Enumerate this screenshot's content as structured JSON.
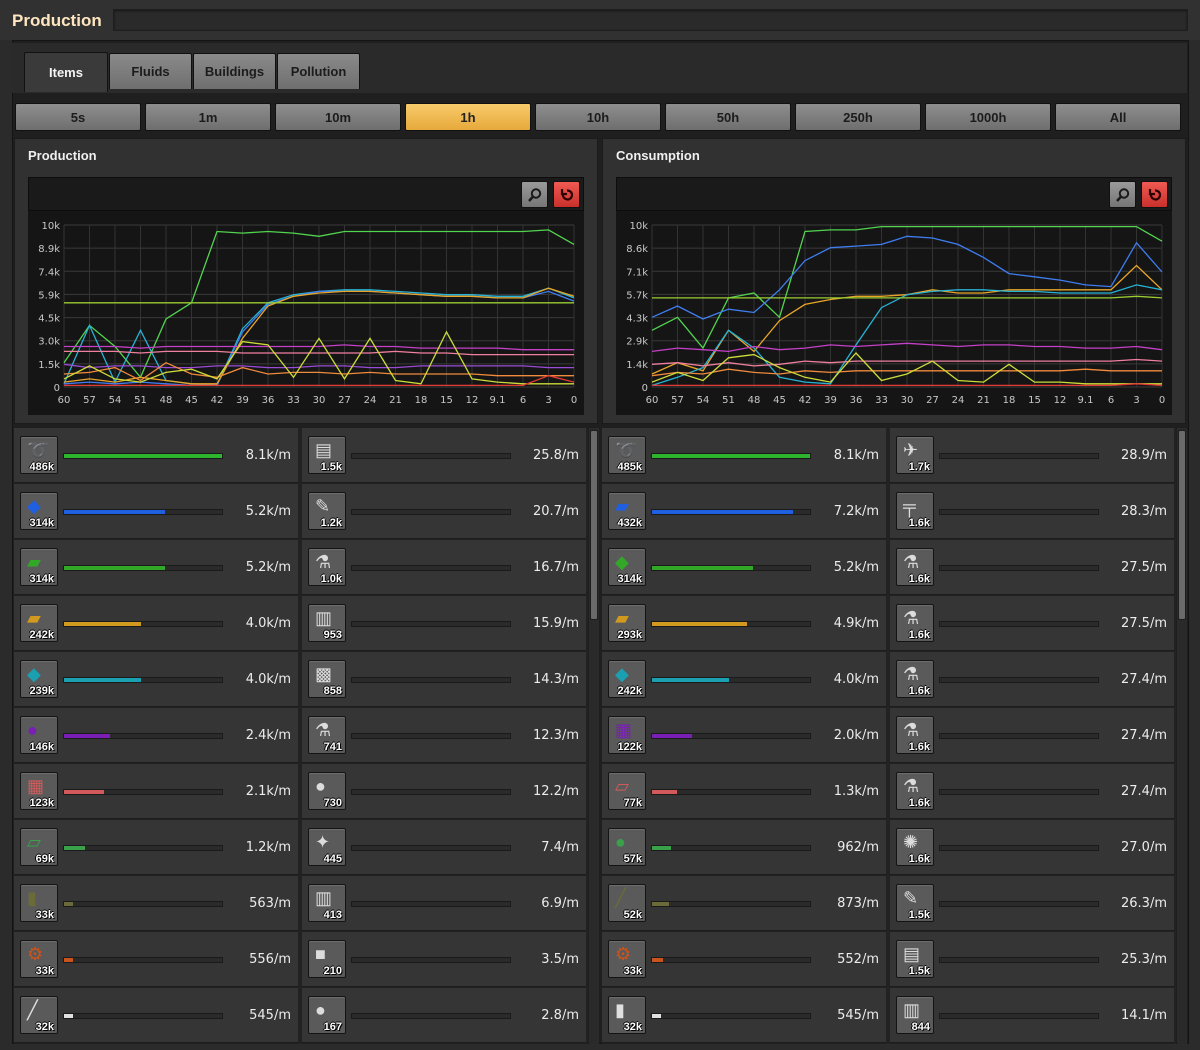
{
  "window": {
    "title": "Production"
  },
  "tabs": [
    {
      "label": "Items",
      "active": true
    },
    {
      "label": "Fluids",
      "active": false
    },
    {
      "label": "Buildings",
      "active": false
    },
    {
      "label": "Pollution",
      "active": false
    }
  ],
  "time_ranges": [
    "5s",
    "1m",
    "10m",
    "1h",
    "10h",
    "50h",
    "250h",
    "1000h",
    "All"
  ],
  "active_time_range": "1h",
  "production": {
    "title": "Production",
    "y_ticks": [
      "10k",
      "8.9k",
      "7.4k",
      "5.9k",
      "4.5k",
      "3.0k",
      "1.5k",
      "0"
    ],
    "x_ticks": [
      "60",
      "57",
      "54",
      "51",
      "48",
      "45",
      "42",
      "39",
      "36",
      "33",
      "30",
      "27",
      "24",
      "21",
      "18",
      "15",
      "12",
      "9.1",
      "6",
      "3",
      "0"
    ],
    "left_items": [
      {
        "icon": "copper-cable-icon",
        "glyph": "➰",
        "count": "486k",
        "rate": "8.1k/m",
        "fraction": 1.0,
        "color": "#2eb52e"
      },
      {
        "icon": "iron-ore-icon",
        "glyph": "◆",
        "count": "314k",
        "rate": "5.2k/m",
        "fraction": 0.64,
        "color": "#1f5fe0"
      },
      {
        "icon": "iron-plate-icon",
        "glyph": "▰",
        "count": "314k",
        "rate": "5.2k/m",
        "fraction": 0.64,
        "color": "#33a828"
      },
      {
        "icon": "copper-plate-icon",
        "glyph": "▰",
        "count": "242k",
        "rate": "4.0k/m",
        "fraction": 0.49,
        "color": "#d19a1e"
      },
      {
        "icon": "copper-ore-icon",
        "glyph": "◆",
        "count": "239k",
        "rate": "4.0k/m",
        "fraction": 0.49,
        "color": "#1aa0b0"
      },
      {
        "icon": "coal-icon",
        "glyph": "●",
        "count": "146k",
        "rate": "2.4k/m",
        "fraction": 0.29,
        "color": "#7a1fb5"
      },
      {
        "icon": "electronic-circuit-icon",
        "glyph": "▦",
        "count": "123k",
        "rate": "2.1k/m",
        "fraction": 0.25,
        "color": "#d25a5a"
      },
      {
        "icon": "steel-plate-icon",
        "glyph": "▱",
        "count": "69k",
        "rate": "1.2k/m",
        "fraction": 0.13,
        "color": "#3aa04a"
      },
      {
        "icon": "explosives-icon",
        "glyph": "▮",
        "count": "33k",
        "rate": "563/m",
        "fraction": 0.06,
        "color": "#6b6b3a"
      },
      {
        "icon": "iron-gear-icon",
        "glyph": "⚙",
        "count": "33k",
        "rate": "556/m",
        "fraction": 0.06,
        "color": "#c9541d"
      },
      {
        "icon": "iron-stick-icon",
        "glyph": "╱",
        "count": "32k",
        "rate": "545/m",
        "fraction": 0.06,
        "color": "#e0e0e0"
      }
    ],
    "right_items": [
      {
        "icon": "advanced-circuit-icon",
        "glyph": "▤",
        "count": "1.5k",
        "rate": "25.8/m"
      },
      {
        "icon": "inserter-icon",
        "glyph": "✎",
        "count": "1.2k",
        "rate": "20.7/m"
      },
      {
        "icon": "science-pack-icon",
        "glyph": "⚗",
        "count": "1.0k",
        "rate": "16.7/m"
      },
      {
        "icon": "grenade-icon",
        "glyph": "▥",
        "count": "953",
        "rate": "15.9/m"
      },
      {
        "icon": "engine-unit-icon",
        "glyph": "▩",
        "count": "858",
        "rate": "14.3/m"
      },
      {
        "icon": "chemical-pack-icon",
        "glyph": "⚗",
        "count": "741",
        "rate": "12.3/m"
      },
      {
        "icon": "stone-icon",
        "glyph": "●",
        "count": "730",
        "rate": "12.2/m"
      },
      {
        "icon": "solar-panel-icon",
        "glyph": "✦",
        "count": "445",
        "rate": "7.4/m"
      },
      {
        "icon": "wall-icon",
        "glyph": "▥",
        "count": "413",
        "rate": "6.9/m"
      },
      {
        "icon": "concrete-icon",
        "glyph": "■",
        "count": "210",
        "rate": "3.5/m"
      },
      {
        "icon": "uranium-ore-icon",
        "glyph": "●",
        "count": "167",
        "rate": "2.8/m"
      }
    ]
  },
  "consumption": {
    "title": "Consumption",
    "y_ticks": [
      "10k",
      "8.6k",
      "7.1k",
      "5.7k",
      "4.3k",
      "2.9k",
      "1.4k",
      "0"
    ],
    "x_ticks": [
      "60",
      "57",
      "54",
      "51",
      "48",
      "45",
      "42",
      "39",
      "36",
      "33",
      "30",
      "27",
      "24",
      "21",
      "18",
      "15",
      "12",
      "9.1",
      "6",
      "3",
      "0"
    ],
    "left_items": [
      {
        "icon": "copper-cable-icon",
        "glyph": "➰",
        "count": "485k",
        "rate": "8.1k/m",
        "fraction": 1.0,
        "color": "#2eb52e"
      },
      {
        "icon": "iron-plate-icon",
        "glyph": "▰",
        "count": "432k",
        "rate": "7.2k/m",
        "fraction": 0.89,
        "color": "#1f5fe0"
      },
      {
        "icon": "iron-ore-icon",
        "glyph": "◆",
        "count": "314k",
        "rate": "5.2k/m",
        "fraction": 0.64,
        "color": "#33a828"
      },
      {
        "icon": "copper-plate-icon",
        "glyph": "▰",
        "count": "293k",
        "rate": "4.9k/m",
        "fraction": 0.6,
        "color": "#d19a1e"
      },
      {
        "icon": "copper-ore-icon",
        "glyph": "◆",
        "count": "242k",
        "rate": "4.0k/m",
        "fraction": 0.49,
        "color": "#1aa0b0"
      },
      {
        "icon": "electronic-circuit-icon",
        "glyph": "▦",
        "count": "122k",
        "rate": "2.0k/m",
        "fraction": 0.25,
        "color": "#7a1fb5"
      },
      {
        "icon": "steel-plate-icon",
        "glyph": "▱",
        "count": "77k",
        "rate": "1.3k/m",
        "fraction": 0.16,
        "color": "#d25a5a"
      },
      {
        "icon": "coal-icon",
        "glyph": "●",
        "count": "57k",
        "rate": "962/m",
        "fraction": 0.12,
        "color": "#3aa04a"
      },
      {
        "icon": "iron-stick-icon",
        "glyph": "╱",
        "count": "52k",
        "rate": "873/m",
        "fraction": 0.11,
        "color": "#6b6b3a"
      },
      {
        "icon": "iron-gear-icon",
        "glyph": "⚙",
        "count": "33k",
        "rate": "552/m",
        "fraction": 0.07,
        "color": "#c9541d"
      },
      {
        "icon": "explosives-icon",
        "glyph": "▮",
        "count": "32k",
        "rate": "545/m",
        "fraction": 0.06,
        "color": "#e0e0e0"
      }
    ],
    "right_items": [
      {
        "icon": "logistic-robot-icon",
        "glyph": "✈",
        "count": "1.7k",
        "rate": "28.9/m"
      },
      {
        "icon": "pipe-icon",
        "glyph": "╤",
        "count": "1.6k",
        "rate": "28.3/m"
      },
      {
        "icon": "automation-pack-icon",
        "glyph": "⚗",
        "count": "1.6k",
        "rate": "27.5/m"
      },
      {
        "icon": "logistic-pack-icon",
        "glyph": "⚗",
        "count": "1.6k",
        "rate": "27.5/m"
      },
      {
        "icon": "military-pack-icon",
        "glyph": "⚗",
        "count": "1.6k",
        "rate": "27.4/m"
      },
      {
        "icon": "production-pack-icon",
        "glyph": "⚗",
        "count": "1.6k",
        "rate": "27.4/m"
      },
      {
        "icon": "utility-pack-icon",
        "glyph": "⚗",
        "count": "1.6k",
        "rate": "27.4/m"
      },
      {
        "icon": "battery-icon",
        "glyph": "✺",
        "count": "1.6k",
        "rate": "27.0/m"
      },
      {
        "icon": "inserter-icon",
        "glyph": "✎",
        "count": "1.5k",
        "rate": "26.3/m"
      },
      {
        "icon": "advanced-circuit-icon",
        "glyph": "▤",
        "count": "1.5k",
        "rate": "25.3/m"
      },
      {
        "icon": "grenade-icon",
        "glyph": "▥",
        "count": "844",
        "rate": "14.1/m"
      }
    ]
  },
  "chart_data": [
    {
      "type": "line",
      "title": "Production",
      "x": [
        60,
        57,
        54,
        51,
        48,
        45,
        42,
        39,
        36,
        33,
        30,
        27,
        24,
        21,
        18,
        15,
        12,
        9.1,
        6,
        3,
        0
      ],
      "ylim": [
        0,
        10000
      ],
      "series": [
        {
          "color": "#52d44f",
          "values": [
            1500,
            3800,
            2500,
            600,
            4200,
            5200,
            9600,
            9500,
            9600,
            9500,
            9300,
            9600,
            9600,
            9600,
            9600,
            9600,
            9600,
            9600,
            9600,
            9700,
            8800
          ]
        },
        {
          "color": "#27b3d6",
          "values": [
            200,
            3800,
            300,
            3500,
            400,
            200,
            100,
            3600,
            5200,
            5700,
            5900,
            6000,
            6000,
            5900,
            5800,
            5700,
            5700,
            5600,
            5600,
            6100,
            5500
          ]
        },
        {
          "color": "#3f7df0",
          "values": [
            200,
            300,
            200,
            300,
            200,
            100,
            100,
            3400,
            5100,
            5600,
            5900,
            5900,
            5900,
            5800,
            5700,
            5600,
            5600,
            5500,
            5500,
            5900,
            5300
          ]
        },
        {
          "color": "#e8a628",
          "values": [
            300,
            500,
            300,
            600,
            400,
            200,
            200,
            3000,
            5000,
            5600,
            5800,
            5900,
            5900,
            5800,
            5700,
            5600,
            5600,
            5500,
            5500,
            6100,
            5600
          ]
        },
        {
          "color": "#9acd32",
          "values": [
            5200,
            5200,
            5200,
            5200,
            5200,
            5200,
            5200,
            5200,
            5200,
            5200,
            5200,
            5200,
            5200,
            5200,
            5200,
            5200,
            5200,
            5200,
            5200,
            5200,
            5200
          ]
        },
        {
          "color": "#c540c8",
          "values": [
            2500,
            2500,
            2500,
            2400,
            2500,
            2500,
            2500,
            2500,
            2500,
            2500,
            2500,
            2600,
            2500,
            2500,
            2400,
            2400,
            2400,
            2400,
            2300,
            2300,
            2300
          ]
        },
        {
          "color": "#f07fa0",
          "values": [
            2200,
            2200,
            2200,
            2100,
            2200,
            2200,
            2200,
            2100,
            2100,
            2100,
            2100,
            2100,
            2100,
            2200,
            2100,
            2100,
            2000,
            2000,
            2000,
            2000,
            2000
          ]
        },
        {
          "color": "#9b4bd6",
          "values": [
            1400,
            1200,
            1300,
            1300,
            1200,
            1200,
            1300,
            1300,
            1200,
            1200,
            1300,
            1300,
            1200,
            1200,
            1300,
            1300,
            1300,
            1300,
            1300,
            1200,
            1200
          ]
        },
        {
          "color": "#f08a3c",
          "values": [
            800,
            900,
            1200,
            400,
            1500,
            800,
            600,
            1200,
            800,
            900,
            900,
            800,
            900,
            800,
            800,
            800,
            800,
            700,
            700,
            700,
            700
          ]
        },
        {
          "color": "#cddc39",
          "values": [
            500,
            1300,
            500,
            300,
            900,
            1100,
            500,
            2800,
            2600,
            600,
            3000,
            500,
            3000,
            400,
            200,
            3400,
            500,
            300,
            200,
            200,
            200
          ]
        },
        {
          "color": "#e53935",
          "values": [
            100,
            100,
            100,
            100,
            100,
            100,
            100,
            100,
            100,
            100,
            100,
            100,
            100,
            100,
            100,
            100,
            100,
            100,
            100,
            700,
            300
          ]
        }
      ]
    },
    {
      "type": "line",
      "title": "Consumption",
      "x": [
        60,
        57,
        54,
        51,
        48,
        45,
        42,
        39,
        36,
        33,
        30,
        27,
        24,
        21,
        18,
        15,
        12,
        9.1,
        6,
        3,
        0
      ],
      "ylim": [
        0,
        10000
      ],
      "series": [
        {
          "color": "#52d44f",
          "values": [
            3500,
            4300,
            2400,
            5500,
            5800,
            4300,
            9600,
            9700,
            9700,
            9900,
            9900,
            9900,
            9900,
            9900,
            9900,
            9900,
            9900,
            9900,
            9900,
            9900,
            9000
          ]
        },
        {
          "color": "#3f7df0",
          "values": [
            4300,
            5000,
            4200,
            4800,
            4600,
            6000,
            7800,
            8600,
            8700,
            8800,
            9300,
            9200,
            8800,
            8000,
            7000,
            6800,
            6600,
            6300,
            6200,
            8900,
            7100
          ]
        },
        {
          "color": "#e8a628",
          "values": [
            800,
            1500,
            1000,
            3500,
            2200,
            4100,
            5100,
            5400,
            5600,
            5600,
            5700,
            6000,
            5800,
            5800,
            6000,
            6000,
            6000,
            6000,
            6000,
            7500,
            6000
          ]
        },
        {
          "color": "#27b3d6",
          "values": [
            100,
            600,
            1200,
            3500,
            2400,
            600,
            300,
            200,
            2600,
            4900,
            5700,
            5900,
            6000,
            6000,
            5900,
            5900,
            5800,
            5800,
            5800,
            6300,
            6000
          ]
        },
        {
          "color": "#9acd32",
          "values": [
            5500,
            5500,
            5500,
            5500,
            5500,
            5500,
            5500,
            5500,
            5500,
            5500,
            5500,
            5500,
            5500,
            5500,
            5500,
            5500,
            5500,
            5500,
            5500,
            5600,
            5500
          ]
        },
        {
          "color": "#c540c8",
          "values": [
            2200,
            2400,
            2300,
            2200,
            2500,
            2300,
            2400,
            2600,
            2500,
            2600,
            2700,
            2600,
            2500,
            2600,
            2600,
            2500,
            2500,
            2400,
            2400,
            2500,
            2300
          ]
        },
        {
          "color": "#f07fa0",
          "values": [
            1400,
            1500,
            1300,
            1500,
            1300,
            1400,
            1600,
            1500,
            1600,
            1600,
            1600,
            1600,
            1600,
            1600,
            1600,
            1600,
            1600,
            1600,
            1600,
            1700,
            1600
          ]
        },
        {
          "color": "#f08a3c",
          "values": [
            700,
            900,
            800,
            1100,
            900,
            800,
            1000,
            900,
            1000,
            1000,
            1000,
            1000,
            1000,
            1000,
            1000,
            1000,
            1000,
            1100,
            1000,
            1000,
            1000
          ]
        },
        {
          "color": "#cddc39",
          "values": [
            300,
            900,
            400,
            1800,
            2000,
            1200,
            600,
            300,
            2100,
            400,
            800,
            1600,
            400,
            300,
            1400,
            300,
            300,
            200,
            200,
            200,
            200
          ]
        },
        {
          "color": "#e53935",
          "values": [
            100,
            100,
            100,
            100,
            100,
            100,
            100,
            100,
            100,
            100,
            100,
            100,
            100,
            100,
            100,
            100,
            100,
            100,
            100,
            200,
            100
          ]
        }
      ]
    }
  ]
}
